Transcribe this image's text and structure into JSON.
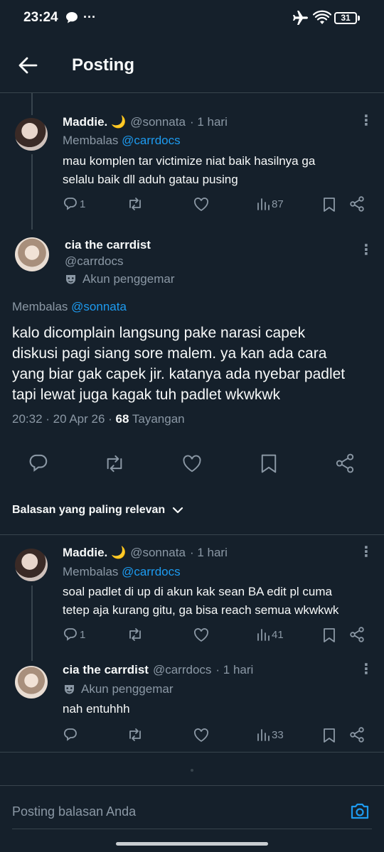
{
  "status_bar": {
    "time": "23:24",
    "battery": "31"
  },
  "header": {
    "title": "Posting"
  },
  "reply1": {
    "name": "Maddie. 🌙",
    "handle": "@sonnata",
    "time": "· 1 hari",
    "replying_prefix": "Membalas",
    "replying_to": "@carrdocs",
    "text_line1": "mau komplen tar victimize niat baik hasilnya ga",
    "text_line2": "selalu baik dll aduh gatau pusing",
    "replies": "1",
    "views": "87"
  },
  "main_post": {
    "name": "cia the carrdist",
    "handle": "@carrdocs",
    "fan_label": "Akun penggemar",
    "replying_prefix": "Membalas",
    "replying_to": "@sonnata",
    "text_lines": [
      "kalo dicomplain langsung pake narasi capek",
      "diskusi pagi siang sore malem. ya kan ada cara",
      "yang biar gak capek jir. katanya ada nyebar padlet",
      "tapi lewat juga kagak tuh padlet wkwkwk"
    ],
    "timestamp": "20:32 · 20 Apr 26 · ",
    "views_count": "68",
    "views_label": " Tayangan"
  },
  "sort": {
    "label": "Balasan yang paling relevan"
  },
  "reply2": {
    "name": "Maddie. 🌙",
    "handle": "@sonnata",
    "time": "· 1 hari",
    "replying_prefix": "Membalas",
    "replying_to": "@carrdocs",
    "text_line1": "soal padlet di up di akun kak sean BA edit pl cuma",
    "text_line2": "tetep aja kurang gitu, ga bisa reach semua wkwkwk",
    "replies": "1",
    "views": "41"
  },
  "reply3": {
    "name": "cia the carrdist",
    "handle": "@carrdocs",
    "time": "· 1 hari",
    "fan_label": "Akun penggemar",
    "text": "nah entuhhh",
    "views": "33"
  },
  "composer": {
    "placeholder": "Posting balasan Anda"
  },
  "colors": {
    "background": "#15202b",
    "accent": "#1d9bf0",
    "muted": "#8b98a5",
    "divider": "#38444d"
  }
}
